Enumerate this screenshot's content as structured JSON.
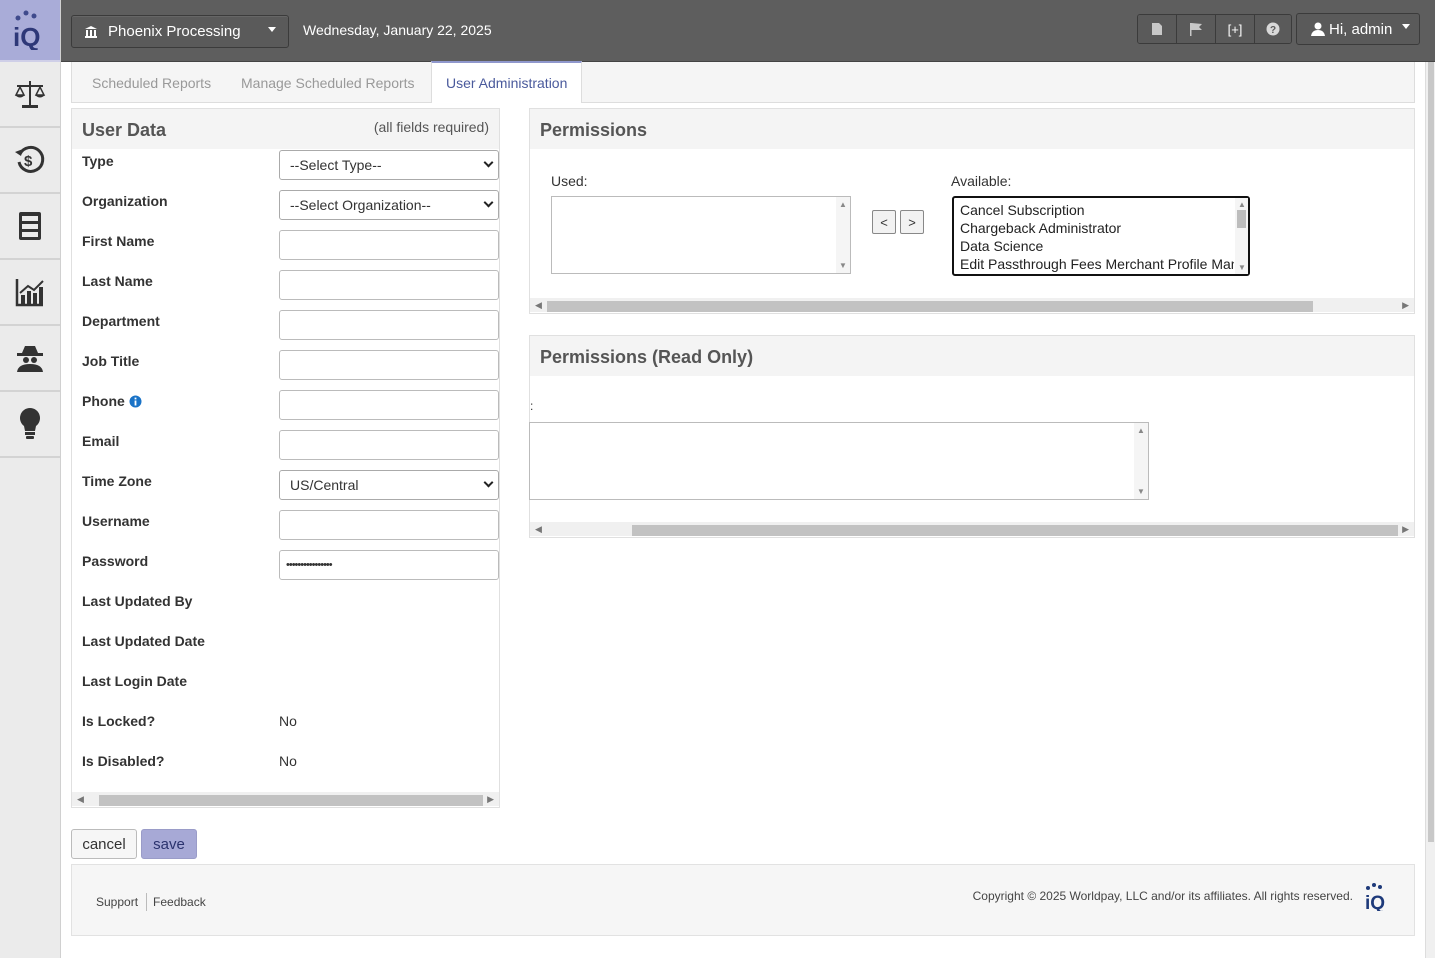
{
  "topbar": {
    "org_name": "Phoenix Processing",
    "date": "Wednesday, January 22, 2025",
    "tool_add_label": "[+]",
    "user_greeting": "Hi, admin"
  },
  "sidebar": {
    "logo_text": "iQ",
    "items": [
      "scales-icon",
      "dollar-history-icon",
      "file-cabinet-icon",
      "chart-icon",
      "spy-icon",
      "lightbulb-icon"
    ]
  },
  "tabs": [
    "Scheduled Reports",
    "Manage Scheduled Reports",
    "User Administration"
  ],
  "user_data": {
    "title": "User Data",
    "note": "(all fields required)",
    "labels": {
      "type": "Type",
      "organization": "Organization",
      "first_name": "First Name",
      "last_name": "Last Name",
      "department": "Department",
      "job_title": "Job Title",
      "phone": "Phone",
      "email": "Email",
      "time_zone": "Time Zone",
      "username": "Username",
      "password": "Password",
      "last_updated_by": "Last Updated By",
      "last_updated_date": "Last Updated Date",
      "last_login_date": "Last Login Date",
      "is_locked": "Is Locked?",
      "is_disabled": "Is Disabled?"
    },
    "values": {
      "type": "--Select Type--",
      "organization": "--Select Organization--",
      "first_name": "",
      "last_name": "",
      "department": "",
      "job_title": "",
      "phone": "",
      "email": "",
      "time_zone": "US/Central",
      "username": "",
      "password": "••••••••••••••••",
      "last_updated_by": "",
      "last_updated_date": "",
      "last_login_date": "",
      "is_locked": "No",
      "is_disabled": "No"
    }
  },
  "permissions": {
    "title": "Permissions",
    "used_label": "Used:",
    "available_label": "Available:",
    "move_left": "<",
    "move_right": ">",
    "available_items": [
      "Cancel Subscription",
      "Chargeback Administrator",
      "Data Science",
      "Edit Passthrough Fees Merchant Profile Man"
    ]
  },
  "permissions_ro": {
    "title": "Permissions (Read Only)",
    "label": ":"
  },
  "actions": {
    "cancel": "cancel",
    "save": "save"
  },
  "footer": {
    "support": "Support",
    "feedback": "Feedback",
    "copyright": "Copyright © 2025 Worldpay, LLC and/or its affiliates. All rights reserved.",
    "logo_text": "iQ"
  },
  "colors": {
    "sidebar_logo_bg": "#a9acd8",
    "topbar_bg": "#5e5e5e",
    "active_tab_text": "#4a5a9c",
    "save_button_bg": "#a7a9d6",
    "info_icon": "#1a73c7"
  }
}
